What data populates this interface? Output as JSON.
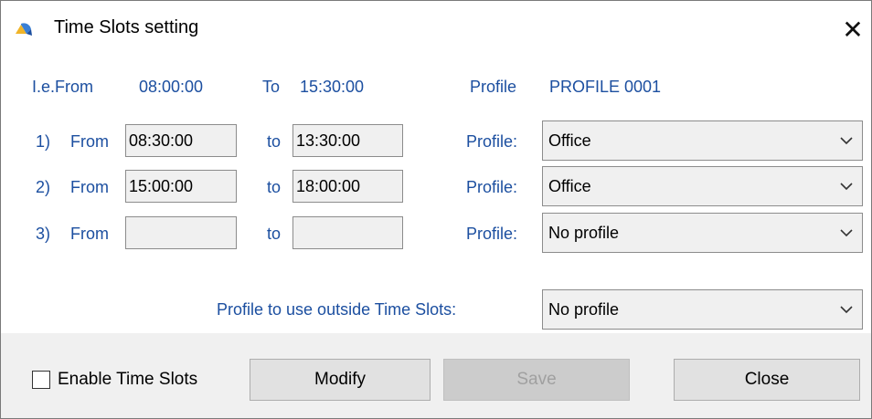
{
  "window": {
    "title": "Time Slots setting",
    "close_glyph": "✕"
  },
  "example": {
    "from_label": "I.e.From",
    "from_value": "08:00:00",
    "to_label": "To",
    "to_value": "15:30:00",
    "profile_label": "Profile",
    "profile_value": "PROFILE 0001"
  },
  "slots": [
    {
      "index": "1)",
      "from_label": "From",
      "from_value": "08:30:00",
      "to_label": "to",
      "to_value": "13:30:00",
      "profile_label": "Profile:",
      "profile_value": "Office"
    },
    {
      "index": "2)",
      "from_label": "From",
      "from_value": "15:00:00",
      "to_label": "to",
      "to_value": "18:00:00",
      "profile_label": "Profile:",
      "profile_value": "Office"
    },
    {
      "index": "3)",
      "from_label": "From",
      "from_value": "",
      "to_label": "to",
      "to_value": "",
      "profile_label": "Profile:",
      "profile_value": "No profile"
    }
  ],
  "outside": {
    "label": "Profile to use outside Time Slots:",
    "value": "No profile"
  },
  "footer": {
    "enable_label": "Enable Time Slots",
    "enable_checked": false,
    "modify_label": "Modify",
    "save_label": "Save",
    "close_label": "Close"
  },
  "colors": {
    "label_blue": "#1c4fa0",
    "footer_bg": "#f0f0f0"
  },
  "icons": {
    "app": "app-icon",
    "close": "close-icon",
    "dropdown": "chevron-down-icon"
  }
}
